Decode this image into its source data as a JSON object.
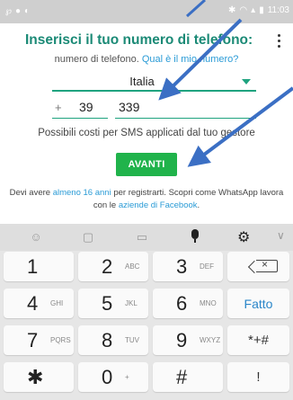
{
  "status_bar": {
    "left_icons": [
      "ℯ",
      "●",
      "◐"
    ],
    "right_text": "11:03"
  },
  "header": {
    "title": "Inserisci il tuo numero di telefono:"
  },
  "subline": {
    "prefix": "numero di telefono.",
    "link": "Qual è il mio numero?"
  },
  "country": {
    "name": "Italia"
  },
  "phone": {
    "plus": "+",
    "code": "39",
    "number": "339"
  },
  "costs_text": "Possibili costi per SMS applicati dal tuo gestore",
  "next_button": "AVANTI",
  "info": {
    "part1": "Devi avere ",
    "age_link": "almeno 16 anni",
    "part2": " per registrarti. Scopri come WhatsApp lavora con le ",
    "companies_link": "aziende di Facebook",
    "part3": "."
  },
  "keyboard": {
    "rows": [
      [
        {
          "big": "1",
          "small": ""
        },
        {
          "big": "2",
          "small": "ABC"
        },
        {
          "big": "3",
          "small": "DEF"
        }
      ],
      [
        {
          "big": "4",
          "small": "GHI"
        },
        {
          "big": "5",
          "small": "JKL"
        },
        {
          "big": "6",
          "small": "MNO"
        }
      ],
      [
        {
          "big": "7",
          "small": "PQRS"
        },
        {
          "big": "8",
          "small": "TUV"
        },
        {
          "big": "9",
          "small": "WXYZ"
        }
      ],
      [
        {
          "big": "*",
          "small": ""
        },
        {
          "big": "0",
          "small": "+"
        },
        {
          "big": "#",
          "small": ""
        }
      ]
    ],
    "done_label": "Fatto",
    "symbols_label": "*+#",
    "excl_label": "!"
  },
  "colors": {
    "accent": "#1b8a76",
    "button": "#20b34b",
    "link": "#2a9bd6",
    "arrow": "#3b6fc4"
  }
}
